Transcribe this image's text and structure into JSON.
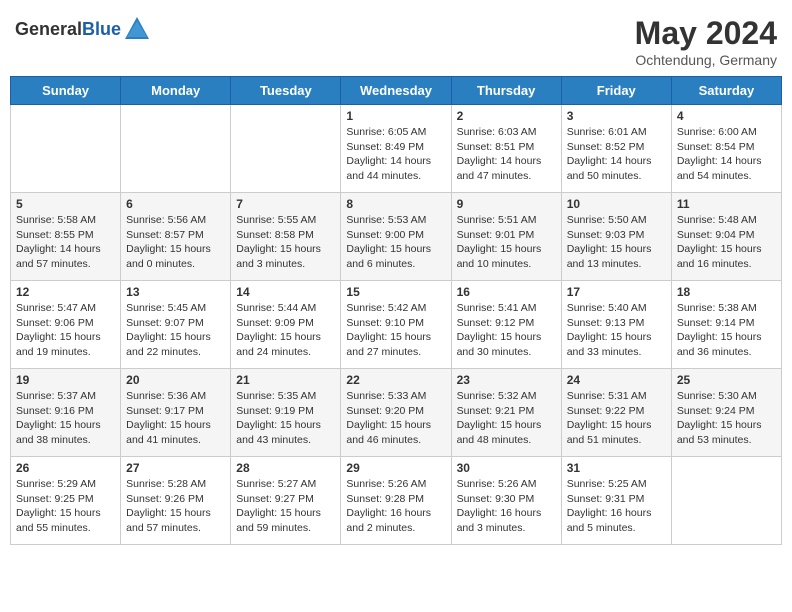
{
  "logo": {
    "text_general": "General",
    "text_blue": "Blue"
  },
  "title": "May 2024",
  "subtitle": "Ochtendung, Germany",
  "headers": [
    "Sunday",
    "Monday",
    "Tuesday",
    "Wednesday",
    "Thursday",
    "Friday",
    "Saturday"
  ],
  "weeks": [
    [
      {
        "day": "",
        "sunrise": "",
        "sunset": "",
        "daylight": ""
      },
      {
        "day": "",
        "sunrise": "",
        "sunset": "",
        "daylight": ""
      },
      {
        "day": "",
        "sunrise": "",
        "sunset": "",
        "daylight": ""
      },
      {
        "day": "1",
        "sunrise": "Sunrise: 6:05 AM",
        "sunset": "Sunset: 8:49 PM",
        "daylight": "Daylight: 14 hours and 44 minutes."
      },
      {
        "day": "2",
        "sunrise": "Sunrise: 6:03 AM",
        "sunset": "Sunset: 8:51 PM",
        "daylight": "Daylight: 14 hours and 47 minutes."
      },
      {
        "day": "3",
        "sunrise": "Sunrise: 6:01 AM",
        "sunset": "Sunset: 8:52 PM",
        "daylight": "Daylight: 14 hours and 50 minutes."
      },
      {
        "day": "4",
        "sunrise": "Sunrise: 6:00 AM",
        "sunset": "Sunset: 8:54 PM",
        "daylight": "Daylight: 14 hours and 54 minutes."
      }
    ],
    [
      {
        "day": "5",
        "sunrise": "Sunrise: 5:58 AM",
        "sunset": "Sunset: 8:55 PM",
        "daylight": "Daylight: 14 hours and 57 minutes."
      },
      {
        "day": "6",
        "sunrise": "Sunrise: 5:56 AM",
        "sunset": "Sunset: 8:57 PM",
        "daylight": "Daylight: 15 hours and 0 minutes."
      },
      {
        "day": "7",
        "sunrise": "Sunrise: 5:55 AM",
        "sunset": "Sunset: 8:58 PM",
        "daylight": "Daylight: 15 hours and 3 minutes."
      },
      {
        "day": "8",
        "sunrise": "Sunrise: 5:53 AM",
        "sunset": "Sunset: 9:00 PM",
        "daylight": "Daylight: 15 hours and 6 minutes."
      },
      {
        "day": "9",
        "sunrise": "Sunrise: 5:51 AM",
        "sunset": "Sunset: 9:01 PM",
        "daylight": "Daylight: 15 hours and 10 minutes."
      },
      {
        "day": "10",
        "sunrise": "Sunrise: 5:50 AM",
        "sunset": "Sunset: 9:03 PM",
        "daylight": "Daylight: 15 hours and 13 minutes."
      },
      {
        "day": "11",
        "sunrise": "Sunrise: 5:48 AM",
        "sunset": "Sunset: 9:04 PM",
        "daylight": "Daylight: 15 hours and 16 minutes."
      }
    ],
    [
      {
        "day": "12",
        "sunrise": "Sunrise: 5:47 AM",
        "sunset": "Sunset: 9:06 PM",
        "daylight": "Daylight: 15 hours and 19 minutes."
      },
      {
        "day": "13",
        "sunrise": "Sunrise: 5:45 AM",
        "sunset": "Sunset: 9:07 PM",
        "daylight": "Daylight: 15 hours and 22 minutes."
      },
      {
        "day": "14",
        "sunrise": "Sunrise: 5:44 AM",
        "sunset": "Sunset: 9:09 PM",
        "daylight": "Daylight: 15 hours and 24 minutes."
      },
      {
        "day": "15",
        "sunrise": "Sunrise: 5:42 AM",
        "sunset": "Sunset: 9:10 PM",
        "daylight": "Daylight: 15 hours and 27 minutes."
      },
      {
        "day": "16",
        "sunrise": "Sunrise: 5:41 AM",
        "sunset": "Sunset: 9:12 PM",
        "daylight": "Daylight: 15 hours and 30 minutes."
      },
      {
        "day": "17",
        "sunrise": "Sunrise: 5:40 AM",
        "sunset": "Sunset: 9:13 PM",
        "daylight": "Daylight: 15 hours and 33 minutes."
      },
      {
        "day": "18",
        "sunrise": "Sunrise: 5:38 AM",
        "sunset": "Sunset: 9:14 PM",
        "daylight": "Daylight: 15 hours and 36 minutes."
      }
    ],
    [
      {
        "day": "19",
        "sunrise": "Sunrise: 5:37 AM",
        "sunset": "Sunset: 9:16 PM",
        "daylight": "Daylight: 15 hours and 38 minutes."
      },
      {
        "day": "20",
        "sunrise": "Sunrise: 5:36 AM",
        "sunset": "Sunset: 9:17 PM",
        "daylight": "Daylight: 15 hours and 41 minutes."
      },
      {
        "day": "21",
        "sunrise": "Sunrise: 5:35 AM",
        "sunset": "Sunset: 9:19 PM",
        "daylight": "Daylight: 15 hours and 43 minutes."
      },
      {
        "day": "22",
        "sunrise": "Sunrise: 5:33 AM",
        "sunset": "Sunset: 9:20 PM",
        "daylight": "Daylight: 15 hours and 46 minutes."
      },
      {
        "day": "23",
        "sunrise": "Sunrise: 5:32 AM",
        "sunset": "Sunset: 9:21 PM",
        "daylight": "Daylight: 15 hours and 48 minutes."
      },
      {
        "day": "24",
        "sunrise": "Sunrise: 5:31 AM",
        "sunset": "Sunset: 9:22 PM",
        "daylight": "Daylight: 15 hours and 51 minutes."
      },
      {
        "day": "25",
        "sunrise": "Sunrise: 5:30 AM",
        "sunset": "Sunset: 9:24 PM",
        "daylight": "Daylight: 15 hours and 53 minutes."
      }
    ],
    [
      {
        "day": "26",
        "sunrise": "Sunrise: 5:29 AM",
        "sunset": "Sunset: 9:25 PM",
        "daylight": "Daylight: 15 hours and 55 minutes."
      },
      {
        "day": "27",
        "sunrise": "Sunrise: 5:28 AM",
        "sunset": "Sunset: 9:26 PM",
        "daylight": "Daylight: 15 hours and 57 minutes."
      },
      {
        "day": "28",
        "sunrise": "Sunrise: 5:27 AM",
        "sunset": "Sunset: 9:27 PM",
        "daylight": "Daylight: 15 hours and 59 minutes."
      },
      {
        "day": "29",
        "sunrise": "Sunrise: 5:26 AM",
        "sunset": "Sunset: 9:28 PM",
        "daylight": "Daylight: 16 hours and 2 minutes."
      },
      {
        "day": "30",
        "sunrise": "Sunrise: 5:26 AM",
        "sunset": "Sunset: 9:30 PM",
        "daylight": "Daylight: 16 hours and 3 minutes."
      },
      {
        "day": "31",
        "sunrise": "Sunrise: 5:25 AM",
        "sunset": "Sunset: 9:31 PM",
        "daylight": "Daylight: 16 hours and 5 minutes."
      },
      {
        "day": "",
        "sunrise": "",
        "sunset": "",
        "daylight": ""
      }
    ]
  ]
}
